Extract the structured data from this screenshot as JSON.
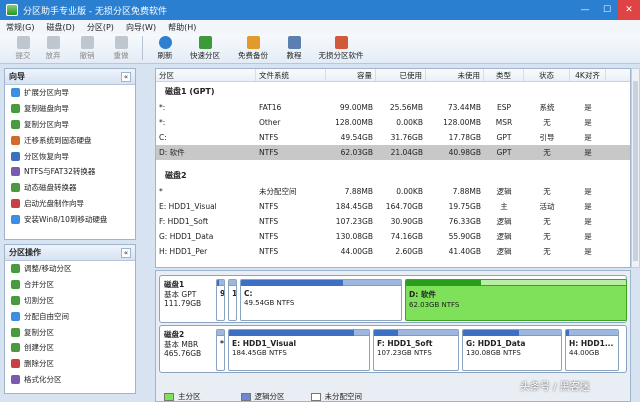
{
  "window": {
    "title": "分区助手专业版 - 无损分区免费软件",
    "min": "—",
    "max": "☐",
    "close": "✕"
  },
  "menu": [
    "常规(G)",
    "磁盘(D)",
    "分区(P)",
    "向导(W)",
    "帮助(H)"
  ],
  "toolbar": [
    {
      "label": "提交",
      "icon": "check-icon",
      "enabled": false,
      "color": "#9aa5b1"
    },
    {
      "label": "放弃",
      "icon": "discard-icon",
      "enabled": false,
      "color": "#9aa5b1"
    },
    {
      "label": "撤销",
      "icon": "undo-icon",
      "enabled": false,
      "color": "#9aa5b1"
    },
    {
      "label": "重做",
      "icon": "redo-icon",
      "enabled": false,
      "color": "#9aa5b1"
    },
    {
      "label": "刷新",
      "icon": "refresh-icon",
      "enabled": true,
      "color": "#2f7fd1"
    },
    {
      "label": "快速分区",
      "icon": "quick-partition-icon",
      "enabled": true,
      "color": "#3d9a38"
    },
    {
      "label": "免费备份",
      "icon": "backup-icon",
      "enabled": true,
      "color": "#e29a2a"
    },
    {
      "label": "教程",
      "icon": "tutorial-icon",
      "enabled": true,
      "color": "#5a7fb0"
    },
    {
      "label": "无损分区软件",
      "icon": "home-icon",
      "enabled": true,
      "color": "#d05a3a"
    }
  ],
  "wizard": {
    "title": "向导",
    "collapse": "«",
    "items": [
      {
        "label": "扩展分区向导",
        "color": "#3b8ee0"
      },
      {
        "label": "复制磁盘向导",
        "color": "#4a9b40"
      },
      {
        "label": "复制分区向导",
        "color": "#4a9b40"
      },
      {
        "label": "迁移系统到固态硬盘",
        "color": "#d46a2a"
      },
      {
        "label": "分区恢复向导",
        "color": "#3b6fbf"
      },
      {
        "label": "NTFS与FAT32转换器",
        "color": "#7a5ab0"
      },
      {
        "label": "动态磁盘转换器",
        "color": "#4a9b40"
      },
      {
        "label": "启动光盘制作向导",
        "color": "#c94040"
      },
      {
        "label": "安装Win8/10到移动硬盘",
        "color": "#3b8ee0"
      }
    ]
  },
  "partops": {
    "title": "分区操作",
    "collapse": "«",
    "items": [
      {
        "label": "调整/移动分区",
        "color": "#4a9b40"
      },
      {
        "label": "合并分区",
        "color": "#4a9b40"
      },
      {
        "label": "切割分区",
        "color": "#4a9b40"
      },
      {
        "label": "分配自由空间",
        "color": "#3b8ee0"
      },
      {
        "label": "复制分区",
        "color": "#4a9b40"
      },
      {
        "label": "创建分区",
        "color": "#4a9b40"
      },
      {
        "label": "删除分区",
        "color": "#c94040"
      },
      {
        "label": "格式化分区",
        "color": "#7a5ab0"
      }
    ]
  },
  "table": {
    "headers": [
      "分区",
      "文件系统",
      "容量",
      "已使用",
      "未使用",
      "类型",
      "状态",
      "4K对齐"
    ],
    "groups": [
      {
        "name": "磁盘1 (GPT)",
        "rows": [
          [
            "*:",
            "FAT16",
            "99.00MB",
            "25.56MB",
            "73.44MB",
            "ESP",
            "系统",
            "是"
          ],
          [
            "*:",
            "Other",
            "128.00MB",
            "0.00KB",
            "128.00MB",
            "MSR",
            "无",
            "是"
          ],
          [
            "C:",
            "NTFS",
            "49.54GB",
            "31.76GB",
            "17.78GB",
            "GPT",
            "引导",
            "是"
          ],
          [
            "D: 软件",
            "NTFS",
            "62.03GB",
            "21.04GB",
            "40.98GB",
            "GPT",
            "无",
            "是"
          ]
        ]
      },
      {
        "name": "磁盘2",
        "rows": [
          [
            "*",
            "未分配空间",
            "7.88MB",
            "0.00KB",
            "7.88MB",
            "逻辑",
            "无",
            "是"
          ],
          [
            "E: HDD1_Visual",
            "NTFS",
            "184.45GB",
            "164.70GB",
            "19.75GB",
            "主",
            "活动",
            "是"
          ],
          [
            "F: HDD1_Soft",
            "NTFS",
            "107.23GB",
            "30.90GB",
            "76.33GB",
            "逻辑",
            "无",
            "是"
          ],
          [
            "G: HDD1_Data",
            "NTFS",
            "130.08GB",
            "74.16GB",
            "55.90GB",
            "逻辑",
            "无",
            "是"
          ],
          [
            "H: HDD1_Per",
            "NTFS",
            "44.00GB",
            "2.60GB",
            "41.40GB",
            "逻辑",
            "无",
            "是"
          ]
        ]
      }
    ],
    "selected_row": "D: 软件"
  },
  "disk1": {
    "name": "磁盘1",
    "type": "基本 GPT",
    "size": "111.79GB",
    "parts": [
      {
        "label": "9",
        "size": "",
        "used": 0.26,
        "kind": "small"
      },
      {
        "label": "1",
        "size": "",
        "used": 0,
        "kind": "small"
      },
      {
        "label": "C:",
        "size": "49.54GB NTFS",
        "used": 0.64,
        "kind": "normal"
      },
      {
        "label": "D: 软件",
        "size": "62.03GB NTFS",
        "used": 0.34,
        "kind": "green"
      }
    ]
  },
  "disk2": {
    "name": "磁盘2",
    "type": "基本 MBR",
    "size": "465.76GB",
    "parts": [
      {
        "label": "*",
        "size": "",
        "used": 0,
        "kind": "small"
      },
      {
        "label": "E: HDD1_Visual",
        "size": "184.45GB NTFS",
        "used": 0.89,
        "kind": "normal"
      },
      {
        "label": "F: HDD1_Soft",
        "size": "107.23GB NTFS",
        "used": 0.29,
        "kind": "normal"
      },
      {
        "label": "G: HDD1_Data",
        "size": "130.08GB NTFS",
        "used": 0.57,
        "kind": "normal"
      },
      {
        "label": "H: HDD1...",
        "size": "44.00GB",
        "used": 0.06,
        "kind": "normal"
      }
    ]
  },
  "legend": [
    {
      "label": "主分区",
      "color": "#7fe05a"
    },
    {
      "label": "逻辑分区",
      "color": "#6f86d8"
    },
    {
      "label": "未分配空间",
      "color": "#ffffff"
    }
  ],
  "watermark": "头条号 / 黑客迷"
}
